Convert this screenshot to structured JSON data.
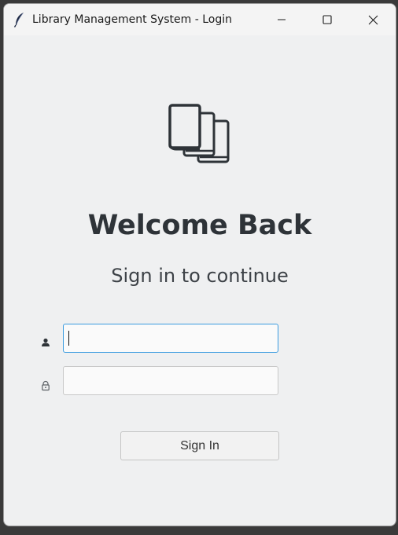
{
  "window": {
    "title": "Library Management System - Login",
    "app_icon": "feather-icon",
    "controls": [
      "minimize-icon",
      "maximize-icon",
      "close-icon"
    ]
  },
  "header": {
    "logo_icon": "books-icon",
    "welcome": "Welcome Back",
    "subtitle": "Sign in to continue"
  },
  "form": {
    "username": {
      "icon": "user-icon",
      "value": "",
      "placeholder": ""
    },
    "password": {
      "icon": "lock-icon",
      "value": "",
      "placeholder": ""
    },
    "submit_label": "Sign In"
  },
  "colors": {
    "background": "#eff0f1",
    "heading": "#2e3338",
    "focus_border": "#3a9be0"
  }
}
